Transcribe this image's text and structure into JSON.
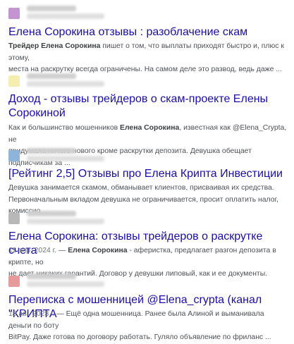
{
  "results": [
    {
      "favicon_color": "#c493d1",
      "title": "Елена Сорокина отзывы : разоблачение скам",
      "snippet": [
        [
          {
            "t": "Трейдер ",
            "b": true
          },
          {
            "t": "Елена Сорокина",
            "b": true
          },
          {
            "t": " пишет о том, что выплаты приходят быстро и, плюс к этому,",
            "b": false
          }
        ],
        [
          {
            "t": "места на раскрутку всегда ограничены. На самом деле это развод, ведь даже ...",
            "b": false
          }
        ]
      ]
    },
    {
      "favicon_color": "#f4efb0",
      "title_lines": [
        "Доход - отзывы трейдеров о скам-проекте Елены",
        "Сорокиной"
      ],
      "snippet": [
        [
          {
            "t": "Как и большинство мошенников ",
            "b": false
          },
          {
            "t": "Елена Сорокина",
            "b": true
          },
          {
            "t": ", известная как @Elena_Crypta, не",
            "b": false
          }
        ],
        [
          {
            "t": "придумала ничего нового кроме раскрутки депозита. Девушка обещает подписчикам за ...",
            "b": false
          }
        ]
      ]
    },
    {
      "favicon_color": "#8fb3d9",
      "title": "[Рейтинг 2,5] Отзывы про Елена Крипта Инвестиции",
      "snippet": [
        [
          {
            "t": "Девушка занимается скамом, обманывает клиентов, присваивая их средства.",
            "b": false
          }
        ],
        [
          {
            "t": "Первоначальным вкладом девушка не ограничивается, просит оплатить налог, комиссио...",
            "b": false
          }
        ]
      ]
    },
    {
      "favicon_color": "#b8b8b8",
      "title": "Елена Сорокина: отзывы трейдеров о раскрутке счета",
      "date": "11 апр. 2024 г.",
      "snippet": [
        [
          {
            "t": " — ",
            "b": false
          },
          {
            "t": "Елена Сорокина",
            "b": true
          },
          {
            "t": " - аферистка, предлагает разгон депозита в крипте, но",
            "b": false
          }
        ],
        [
          {
            "t": "не дает никаких гарантий. Договор у девушки липовый, как и ее документы.",
            "b": false
          }
        ]
      ]
    },
    {
      "favicon_color": "#e79a9a",
      "title": "Переписка с мошенницей @Elena_crypta (канал \"КРИПТА",
      "date": "18 авг. 2023 г.",
      "snippet": [
        [
          {
            "t": " — Ещё одна мошенница. Ранее была Алиной и выманивала деньги по боту",
            "b": false
          }
        ],
        [
          {
            "t": "BitPay. Даже готова по договору работать. Гуляло объявление по фриланс ...",
            "b": false
          }
        ]
      ]
    }
  ]
}
